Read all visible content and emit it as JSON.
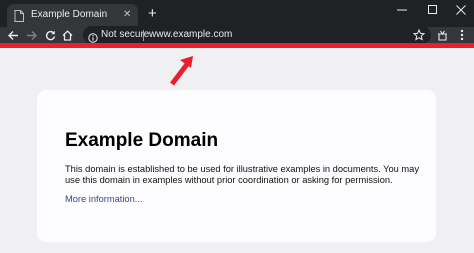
{
  "browser": {
    "tab_title": "Example Domain",
    "new_tab_icon": "plus-icon",
    "window_controls": [
      "minimize",
      "maximize",
      "close"
    ],
    "security_label": "Not secure",
    "url": "www.example.com"
  },
  "page": {
    "heading": "Example Domain",
    "body": "This domain is established to be used for illustrative examples in documents. You may use this domain in examples without prior coordination or asking for permission.",
    "link": "More information..."
  },
  "colors": {
    "accent_bar": "#e8202e",
    "arrow": "#e8202e",
    "link": "#38488f"
  }
}
